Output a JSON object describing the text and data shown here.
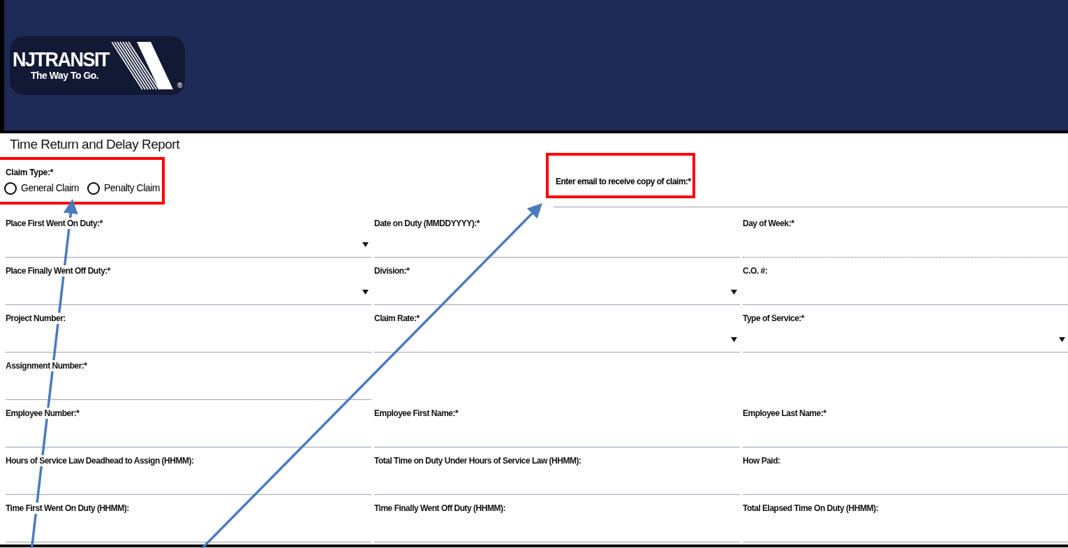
{
  "header": {
    "logo_wordmark": "NJTRANSIT",
    "logo_tagline": "The Way To Go.",
    "logo_mark": "®"
  },
  "title": "Time Return and Delay Report",
  "claim_type": {
    "label": "Claim Type:*",
    "highlighted": true,
    "options": [
      {
        "label": "General Claim",
        "selected": false
      },
      {
        "label": "Penalty Claim",
        "selected": false
      }
    ]
  },
  "email": {
    "label": "Enter email to receive copy of claim:*",
    "highlighted": true
  },
  "rows": [
    [
      {
        "label": "Place First Went On Duty:*",
        "kind": "select"
      },
      {
        "label": "Date on Duty (MMDDYYYY):*",
        "kind": "text"
      },
      {
        "label": "Day of Week:*",
        "kind": "readonly"
      }
    ],
    [
      {
        "label": "Place Finally Went Off Duty:*",
        "kind": "select"
      },
      {
        "label": "Division:*",
        "kind": "select"
      },
      {
        "label": "C.O. #:",
        "kind": "text"
      }
    ],
    [
      {
        "label": "Project Number:",
        "kind": "text"
      },
      {
        "label": "Claim Rate:*",
        "kind": "select"
      },
      {
        "label": "Type of Service:*",
        "kind": "select"
      }
    ],
    [
      {
        "label": "Assignment Number:*",
        "kind": "text"
      },
      {
        "kind": "empty"
      },
      {
        "kind": "empty"
      }
    ],
    [
      {
        "label": "Employee Number:*",
        "kind": "text"
      },
      {
        "label": "Employee First Name:*",
        "kind": "text"
      },
      {
        "label": "Employee Last Name:*",
        "kind": "text"
      }
    ],
    [
      {
        "label": "Hours of Service Law Deadhead to Assign (HHMM):",
        "kind": "text"
      },
      {
        "label": "Total Time on Duty Under Hours of Service Law (HHMM):",
        "kind": "text"
      },
      {
        "label": "How Paid:",
        "kind": "text"
      }
    ],
    [
      {
        "label": "Time First Went On Duty (HHMM):",
        "kind": "text"
      },
      {
        "label": "Time Finally Went Off Duty (HHMM):",
        "kind": "text"
      },
      {
        "label": "Total Elapsed Time On Duty (HHMM):",
        "kind": "text"
      }
    ]
  ],
  "annotations": [
    {
      "kind": "arrow"
    },
    {
      "kind": "arrow"
    }
  ]
}
